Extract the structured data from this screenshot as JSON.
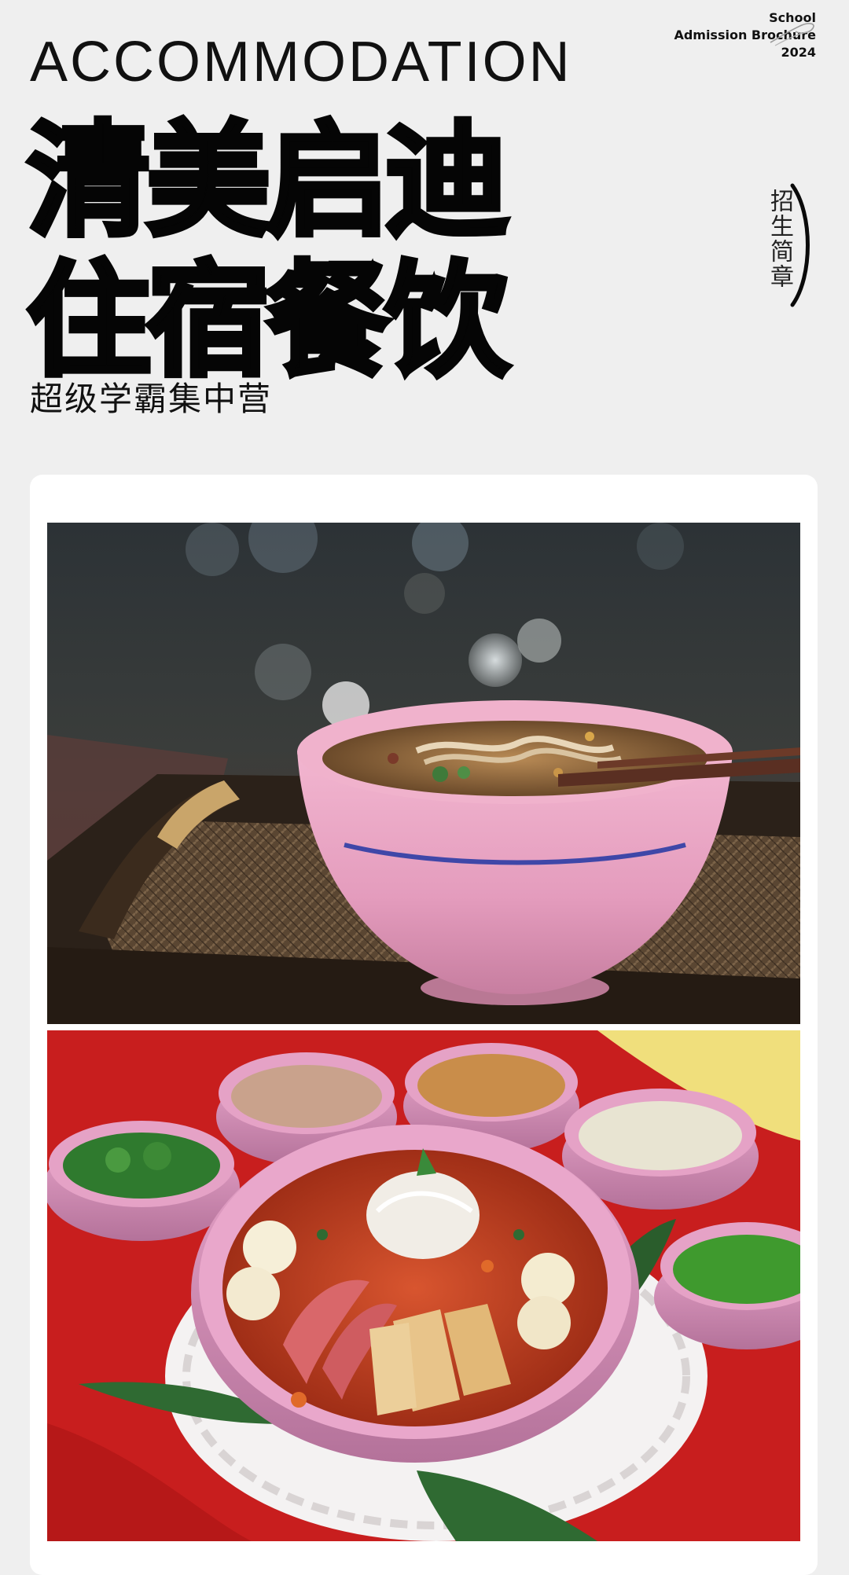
{
  "brochure": {
    "line1": "School",
    "line2": "Admission Brochure",
    "line3": "2024"
  },
  "header": {
    "eyebrow": "ACCOMMODATION",
    "headline_line1": "清美启迪",
    "headline_line2": "住宿餐饮",
    "subtitle": "超级学霸集中营",
    "vertical_tag": "招生简章"
  },
  "gallery": {
    "photo1_alt": "pink bowl of noodle soup with chopsticks on a woven wooden tray",
    "photo2_alt": "pink bowl of spicy noodles with eggs and tofu surrounded by side bowls of condiments on a red tablecloth"
  },
  "colors": {
    "page_background": "#efefef",
    "card_background": "#ffffff",
    "text": "#0d0d0d",
    "bowl_pink": "#e7a3c6",
    "tablecloth_red": "#c81e1e"
  }
}
